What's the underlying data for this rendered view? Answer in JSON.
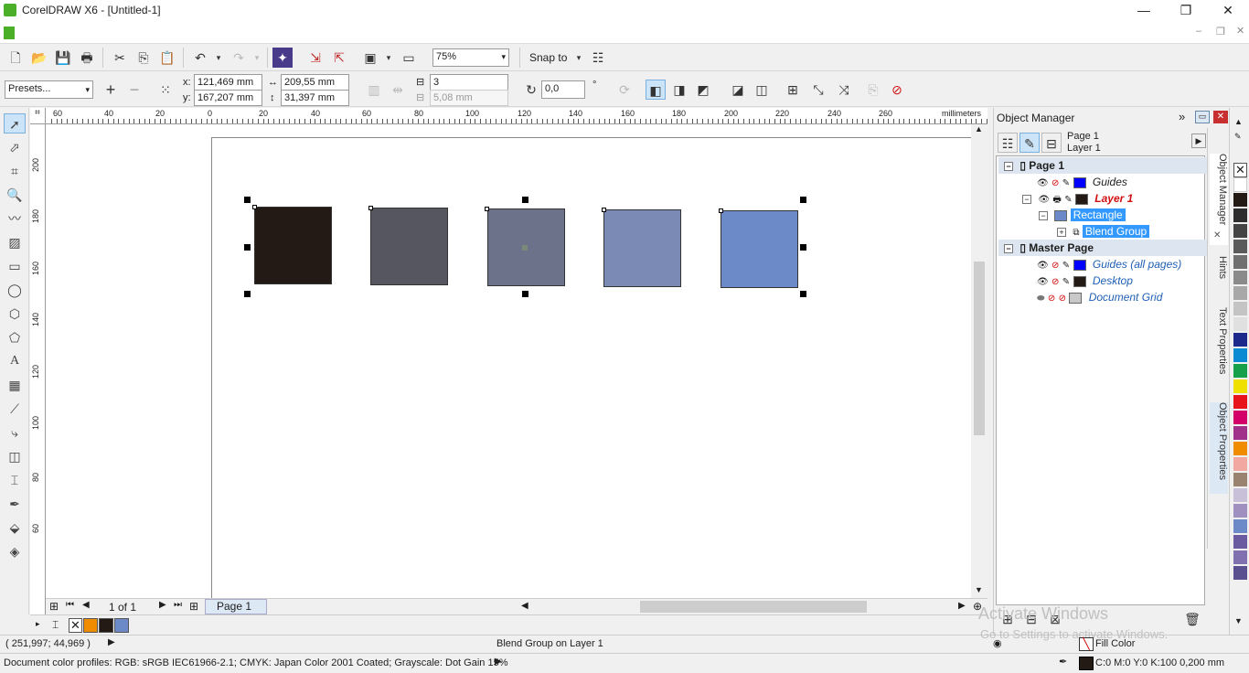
{
  "window": {
    "title": "CorelDRAW X6 - [Untitled-1]",
    "minimize": "—",
    "maximize": "❐",
    "close": "✕"
  },
  "standard_bar": {
    "zoom": "75%",
    "snap_to": "Snap to"
  },
  "property_bar": {
    "presets": "Presets...",
    "x_label": "x:",
    "x_value": "121,469 mm",
    "y_label": "y:",
    "y_value": "167,207 mm",
    "width_value": "209,55 mm",
    "height_value": "31,397 mm",
    "steps_value": "3",
    "spacing_value": "5,08 mm",
    "angle_value": "0,0",
    "angle_unit": "°"
  },
  "rulers": {
    "unit": "millimeters",
    "h_labels": [
      "60",
      "40",
      "20",
      "0",
      "20",
      "40",
      "60",
      "80",
      "100",
      "120",
      "140",
      "160",
      "180",
      "200",
      "220",
      "240",
      "260"
    ],
    "v_labels": [
      "200",
      "180",
      "160",
      "140",
      "120",
      "100",
      "80",
      "60"
    ]
  },
  "blend": {
    "colors": [
      "#231915",
      "#555660",
      "#6b7289",
      "#7b8ab4",
      "#6d8ac8"
    ]
  },
  "page_nav": {
    "counter": "1 of 1",
    "tab": "Page 1"
  },
  "color_well": {
    "colors": [
      "#f08c00",
      "#231915",
      "#6d8ac8"
    ]
  },
  "object_manager": {
    "title": "Object Manager",
    "page_label": "Page 1",
    "layer_label": "Layer 1",
    "tree": {
      "page": "Page 1",
      "guides": "Guides",
      "layer": "Layer 1",
      "rectangle": "Rectangle",
      "blend_group": "Blend Group",
      "master": "Master Page",
      "guides_all": "Guides (all pages)",
      "desktop": "Desktop",
      "doc_grid": "Document Grid"
    },
    "colors": {
      "guides": "#0000ff",
      "layer": "#231915",
      "rectangle": "#6d8ac8",
      "desktop": "#231915",
      "grid": "#c8c8c8"
    }
  },
  "docker_tabs": [
    "Object Manager",
    "Hints",
    "Text Properties",
    "Object Properties"
  ],
  "palette": [
    "#ffffff",
    "#231915",
    "#2d2d2d",
    "#444444",
    "#5a5a5a",
    "#707070",
    "#8a8a8a",
    "#a8a8a8",
    "#c4c4c4",
    "#e0e0e0",
    "#1d2a8c",
    "#0b8ad4",
    "#16a04a",
    "#f0e000",
    "#e8141c",
    "#d4006a",
    "#a0308a",
    "#f08c00",
    "#f0a8a0",
    "#9a8270",
    "#c8c0d8",
    "#a090c0",
    "#6d8ac8",
    "#6a5aa0",
    "#8070b0",
    "#5a5090"
  ],
  "status": {
    "coords": "( 251,997; 44,969 )",
    "selection": "Blend Group on Layer 1",
    "fill_label": "Fill Color",
    "outline_label": "C:0 M:0 Y:0 K:100  0,200 mm",
    "profiles": "Document color profiles: RGB: sRGB IEC61966-2.1; CMYK: Japan Color 2001 Coated; Grayscale: Dot Gain 15%",
    "activate_title": "Activate Windows",
    "activate_sub": "Go to Settings to activate Windows."
  }
}
